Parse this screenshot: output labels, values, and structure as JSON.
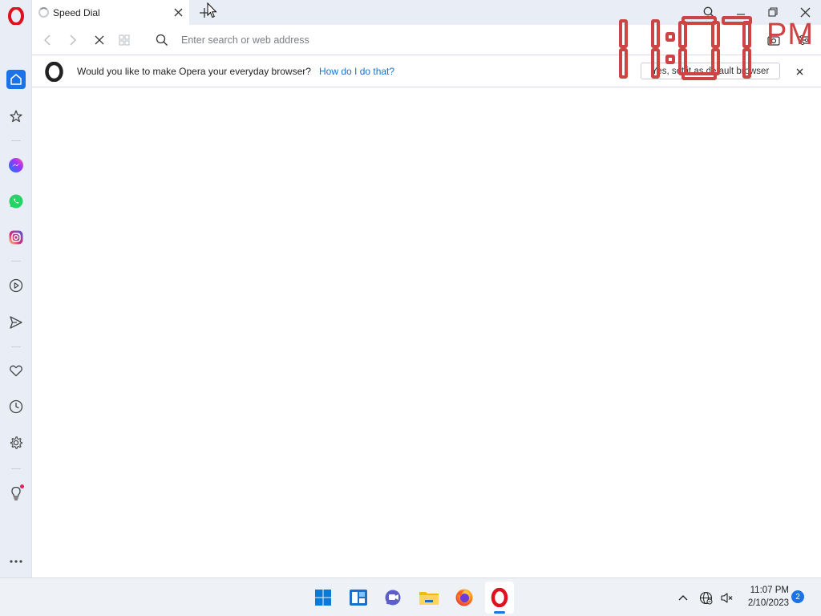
{
  "tabs": [
    {
      "title": "Speed Dial",
      "active": true
    }
  ],
  "addressbar": {
    "placeholder": "Enter search or web address",
    "value": ""
  },
  "clock_overlay": {
    "time_digits": "1:07",
    "period": "PM",
    "color": "#c44444"
  },
  "notification": {
    "message": "Would you like to make Opera your everyday browser?",
    "link_label": "How do I do that?",
    "button_label": "Yes, set it as default browser"
  },
  "sidebar": {
    "items": [
      {
        "name": "home",
        "icon": "home-icon",
        "active": true
      },
      {
        "name": "bookmarks",
        "icon": "star-icon"
      },
      {
        "name": "messenger",
        "icon": "messenger-icon"
      },
      {
        "name": "whatsapp",
        "icon": "whatsapp-icon"
      },
      {
        "name": "instagram",
        "icon": "instagram-icon"
      },
      {
        "name": "player",
        "icon": "play-icon"
      },
      {
        "name": "my-flow",
        "icon": "send-icon"
      },
      {
        "name": "pinboards",
        "icon": "heart-icon"
      },
      {
        "name": "history",
        "icon": "clock-icon"
      },
      {
        "name": "settings",
        "icon": "gear-icon"
      },
      {
        "name": "tips",
        "icon": "lightbulb-icon"
      },
      {
        "name": "more",
        "icon": "more-icon"
      }
    ]
  },
  "taskbar": {
    "apps": [
      {
        "name": "start",
        "icon": "windows-icon"
      },
      {
        "name": "widgets",
        "icon": "widgets-icon"
      },
      {
        "name": "teams-chat",
        "icon": "chat-icon"
      },
      {
        "name": "file-explorer",
        "icon": "folder-icon"
      },
      {
        "name": "firefox",
        "icon": "firefox-icon"
      },
      {
        "name": "opera",
        "icon": "opera-icon",
        "active": true
      }
    ],
    "time": "11:07 PM",
    "date": "2/10/2023",
    "notification_count": "2"
  },
  "colors": {
    "accent": "#1a73e8",
    "opera_red": "#e0101e",
    "sidebar_bg": "#e9eef6",
    "link": "#1a73c8"
  }
}
